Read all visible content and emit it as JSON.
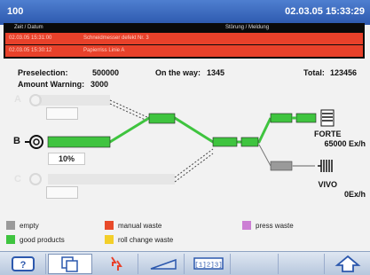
{
  "titlebar": {
    "left": "100",
    "right": "02.03.05 15:33:29"
  },
  "alarms": {
    "header": {
      "col_time": "Zeit / Datum",
      "col_message": "Störung / Meldung"
    },
    "rows": [
      {
        "time": "02.03.05 15:31:00",
        "message": "Schneidmesser defekt Nr. 3"
      },
      {
        "time": "02.03.05 15:30:12",
        "message": "Papierriss Linie A"
      }
    ]
  },
  "info": {
    "preselection_label": "Preselection:",
    "preselection_value": "500000",
    "on_the_way_label": "On the way:",
    "on_the_way_value": "1345",
    "total_label": "Total:",
    "total_value": "123456",
    "amount_warning_label": "Amount Warning:",
    "amount_warning_value": "3000"
  },
  "lanes": {
    "a": "A",
    "b": "B",
    "c": "C",
    "b_percent": "10%"
  },
  "outputs": {
    "forte_name": "FORTE",
    "forte_rate": "65000 Ex/h",
    "vivo_name": "VIVO",
    "vivo_rate": "0Ex/h"
  },
  "legend": {
    "empty": "empty",
    "manual_waste": "manual waste",
    "press_waste": "press waste",
    "good_products": "good products",
    "roll_change_waste": "roll change waste"
  },
  "colors": {
    "good": "#3fc43f",
    "empty": "#9a9a9a",
    "manual": "#e84a2a",
    "press": "#cc7ed4",
    "roll": "#f3cf2a",
    "alarm": "#e8412a",
    "accent": "#2c58ad"
  },
  "toolbar": {
    "help_icon": "help-question-icon",
    "copy_icon": "copy-pages-icon",
    "waste_icon": "red-arrows-icon",
    "ramp_icon": "speed-ramp-icon",
    "counter_label": "[1]2]3]",
    "home_icon": "home-arrow-icon"
  }
}
